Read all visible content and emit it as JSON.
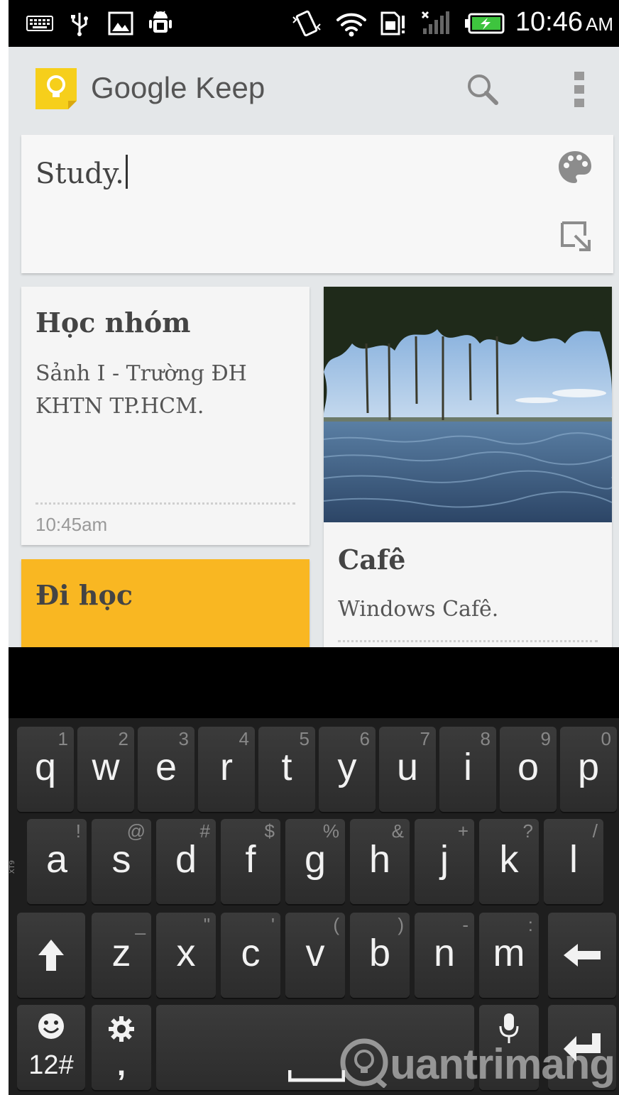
{
  "status_bar": {
    "time": "10:46",
    "ampm": "AM",
    "icons": [
      "keyboard-icon",
      "usb-icon",
      "image-icon",
      "android-debug-icon",
      "vibrate-icon",
      "wifi-icon",
      "sim-icon",
      "signal-icon",
      "battery-charging-icon"
    ]
  },
  "app_bar": {
    "title": "Google Keep",
    "icons": [
      "keep-logo-icon",
      "search-icon",
      "overflow-menu-icon"
    ]
  },
  "new_note": {
    "text": "Study.",
    "icons": [
      "palette-icon",
      "expand-note-icon"
    ]
  },
  "notes": [
    {
      "title": "Học nhóm",
      "body_lines": [
        "Sảnh I - Trường ĐH",
        "KHTN TP.HCM."
      ],
      "time": "10:45am"
    },
    {
      "title": "Đi học",
      "color": "#f9b722"
    },
    {
      "title": "Cafê",
      "body": "Windows Cafê.",
      "image": "lake-with-tree-photo"
    }
  ],
  "keyboard": {
    "row1": [
      {
        "key": "q",
        "hint": "1"
      },
      {
        "key": "w",
        "hint": "2"
      },
      {
        "key": "e",
        "hint": "3"
      },
      {
        "key": "r",
        "hint": "4"
      },
      {
        "key": "t",
        "hint": "5"
      },
      {
        "key": "y",
        "hint": "6"
      },
      {
        "key": "u",
        "hint": "7"
      },
      {
        "key": "i",
        "hint": "8"
      },
      {
        "key": "o",
        "hint": "9"
      },
      {
        "key": "p",
        "hint": "0"
      }
    ],
    "row2": [
      {
        "key": "a",
        "hint": "!"
      },
      {
        "key": "s",
        "hint": "@"
      },
      {
        "key": "d",
        "hint": "#"
      },
      {
        "key": "f",
        "hint": "$"
      },
      {
        "key": "g",
        "hint": "%"
      },
      {
        "key": "h",
        "hint": "&"
      },
      {
        "key": "j",
        "hint": "+"
      },
      {
        "key": "k",
        "hint": "?"
      },
      {
        "key": "l",
        "hint": "/"
      }
    ],
    "row3": [
      {
        "key": "z",
        "hint": "_"
      },
      {
        "key": "x",
        "hint": "\""
      },
      {
        "key": "c",
        "hint": "'"
      },
      {
        "key": "v",
        "hint": "("
      },
      {
        "key": "b",
        "hint": ")"
      },
      {
        "key": "n",
        "hint": "-"
      },
      {
        "key": "m",
        "hint": ":"
      }
    ],
    "symbols_label": "12#",
    "comma_label": ",",
    "side_label": "XT9",
    "icons": [
      "shift-icon",
      "backspace-icon",
      "emoji-icon",
      "settings-icon",
      "space-icon",
      "mic-icon",
      "enter-icon"
    ]
  },
  "watermark": {
    "text": "uantrimang",
    "icon": "quantrimang-logo-icon"
  }
}
